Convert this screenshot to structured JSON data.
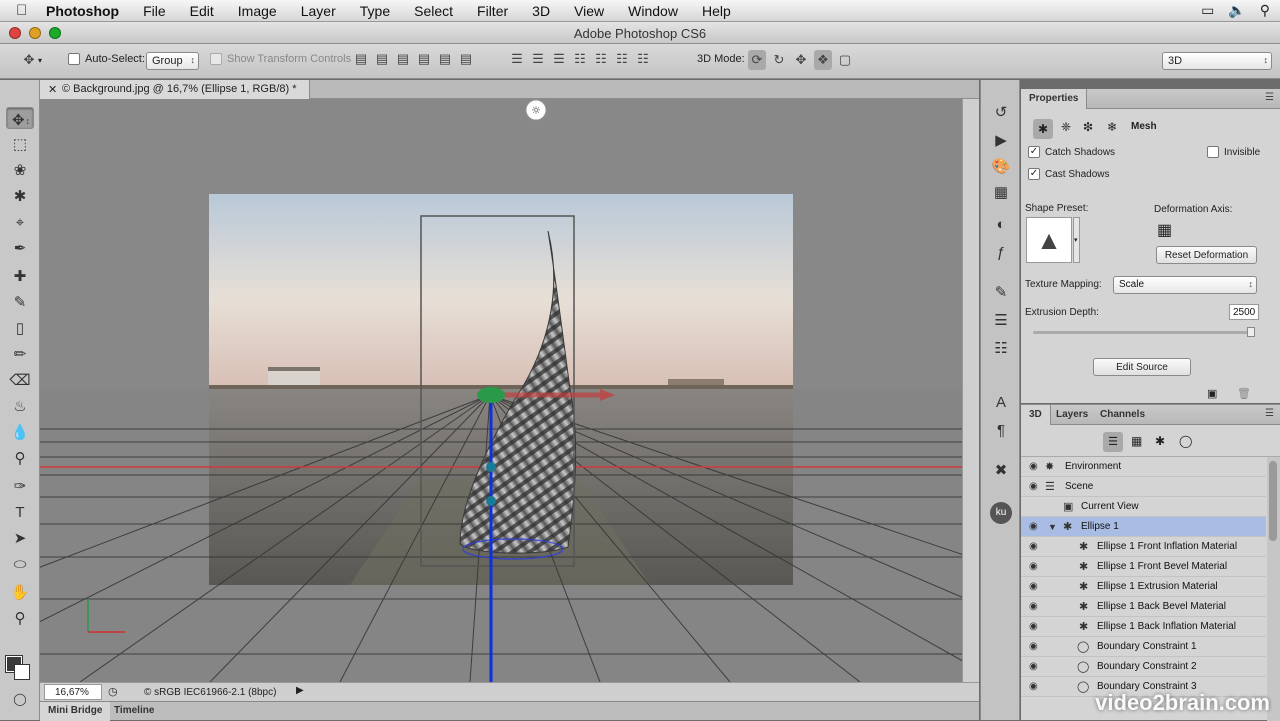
{
  "menubar": {
    "app": "Photoshop",
    "items": [
      "File",
      "Edit",
      "Image",
      "Layer",
      "Type",
      "Select",
      "Filter",
      "3D",
      "View",
      "Window",
      "Help"
    ]
  },
  "window": {
    "title": "Adobe Photoshop CS6"
  },
  "options": {
    "auto_select_label": "Auto-Select:",
    "auto_select_value": "Group",
    "show_transform_label": "Show Transform Controls",
    "mode_label": "3D Mode:",
    "workspace": "3D"
  },
  "document": {
    "tab_title": "© Background.jpg @ 16,7% (Ellipse 1, RGB/8) *",
    "zoom": "16,67%",
    "doc_info": "© sRGB IEC61966-2.1 (8bpc)"
  },
  "bottom_tabs": [
    "Mini Bridge",
    "Timeline"
  ],
  "properties": {
    "tab": "Properties",
    "section": "Mesh",
    "catch_shadows": "Catch Shadows",
    "cast_shadows": "Cast Shadows",
    "invisible": "Invisible",
    "shape_preset": "Shape Preset:",
    "deformation_axis": "Deformation Axis:",
    "reset_deformation": "Reset Deformation",
    "texture_mapping_label": "Texture Mapping:",
    "texture_mapping_value": "Scale",
    "extrusion_depth_label": "Extrusion Depth:",
    "extrusion_depth_value": "2500",
    "edit_source": "Edit Source"
  },
  "panel_tabs": [
    "3D",
    "Layers",
    "Channels"
  ],
  "scene_items": [
    {
      "label": "Environment"
    },
    {
      "label": "Scene"
    },
    {
      "label": "Current View"
    },
    {
      "label": "Ellipse 1"
    },
    {
      "label": "Ellipse 1 Front Inflation Material"
    },
    {
      "label": "Ellipse 1 Front Bevel Material"
    },
    {
      "label": "Ellipse 1 Extrusion Material"
    },
    {
      "label": "Ellipse 1 Back Bevel Material"
    },
    {
      "label": "Ellipse 1 Back Inflation Material"
    },
    {
      "label": "Boundary Constraint 1"
    },
    {
      "label": "Boundary Constraint 2"
    },
    {
      "label": "Boundary Constraint 3"
    }
  ],
  "watermark": "video2brain.com",
  "colors": {
    "selected_row": "#a9bce4",
    "axis_x": "#d03030",
    "axis_y": "#2a9a4a",
    "axis_z": "#1030e0"
  }
}
